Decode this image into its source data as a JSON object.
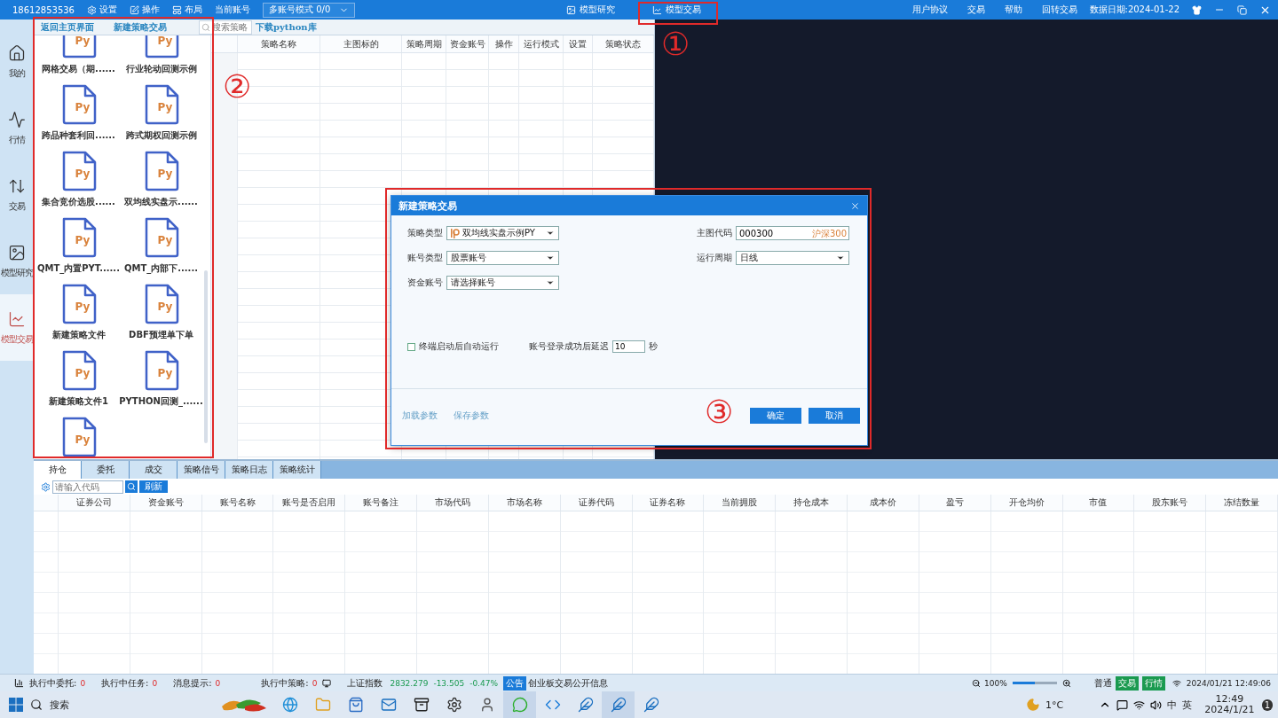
{
  "top_bar": {
    "phone": "18612853536",
    "menu": [
      {
        "label": "设置",
        "kind": "settings"
      },
      {
        "label": "操作",
        "kind": "edit"
      },
      {
        "label": "布局",
        "kind": "layout"
      }
    ],
    "account_label": "当前账号",
    "account_mode": "多账号模式 0/0",
    "modules": [
      {
        "label": "模型研究",
        "kind": "research"
      },
      {
        "label": "模型交易",
        "kind": "trade"
      }
    ],
    "links": [
      "用户协议",
      "交易",
      "帮助",
      "回转交易"
    ],
    "data_date": "数据日期:2024-01-22"
  },
  "sidebar": {
    "items": [
      {
        "label": "我的",
        "kind": "home",
        "selected": false
      },
      {
        "label": "行情",
        "kind": "market",
        "selected": false
      },
      {
        "label": "交易",
        "kind": "trade",
        "selected": false
      },
      {
        "label": "模型研究",
        "kind": "research",
        "selected": false
      },
      {
        "label": "模型交易",
        "kind": "model",
        "selected": true
      }
    ]
  },
  "file_panel": {
    "back": "返回主页界面",
    "new": "新建策略交易",
    "search": {
      "placeholder": "搜索策略"
    },
    "download": "下载python库",
    "files": [
      {
        "badge": "Py",
        "label": "网格交易（期......"
      },
      {
        "badge": "Py",
        "label": "行业轮动回测示例"
      },
      {
        "badge": "Py",
        "label": "跨品种套利回......"
      },
      {
        "badge": "Py",
        "label": "跨式期权回测示例"
      },
      {
        "badge": "Py",
        "label": "集合竞价选股......"
      },
      {
        "badge": "Py",
        "label": "双均线实盘示......"
      },
      {
        "badge": "Py",
        "label": "QMT_内置PYT......"
      },
      {
        "badge": "Py",
        "label": "QMT_内部下......"
      },
      {
        "badge": "Py",
        "label": "新建策略文件"
      },
      {
        "badge": "Py",
        "label": "DBF预埋单下单"
      },
      {
        "badge": "Py",
        "label": "新建策略文件1"
      },
      {
        "badge": "Py",
        "label": "PYTHON回测_......"
      },
      {
        "badge": "Py"
      }
    ]
  },
  "strategy_table": {
    "columns": [
      "策略名称",
      "主图标的",
      "策略周期",
      "资金账号",
      "操作",
      "运行模式",
      "设置",
      "策略状态"
    ]
  },
  "dialog": {
    "title": "新建策略交易",
    "fields": [
      {
        "label": "策略类型",
        "kind": "script",
        "value": "双均线实盘示例PY"
      },
      {
        "label": "主图代码",
        "kind": "code",
        "value": "000300",
        "hint": "沪深300"
      },
      {
        "label": "账号类型",
        "kind": "select",
        "value": "股票账号"
      },
      {
        "label": "运行周期",
        "kind": "select",
        "value": "日线"
      },
      {
        "label": "资金账号",
        "kind": "select",
        "value": "请选择账号"
      }
    ],
    "auto_run": {
      "label": "终端启动后自动运行",
      "checked": false
    },
    "delay": {
      "label": "账号登录成功后延迟",
      "value": "10",
      "unit": "秒"
    },
    "links": [
      "加载参数",
      "保存参数"
    ],
    "buttons": [
      "确定",
      "取消"
    ]
  },
  "annotations": [
    {
      "label": "①"
    },
    {
      "label": "②"
    },
    {
      "label": "③"
    }
  ],
  "bottom_panel": {
    "tabs": [
      {
        "label": "持仓",
        "selected": true
      },
      {
        "label": "委托",
        "selected": false
      },
      {
        "label": "成交",
        "selected": false
      },
      {
        "label": "策略信号",
        "selected": false
      },
      {
        "label": "策略日志",
        "selected": false
      },
      {
        "label": "策略统计",
        "selected": false
      }
    ],
    "search": {
      "placeholder": "请输入代码"
    },
    "refresh": "刷新",
    "columns": [
      "证券公司",
      "资金账号",
      "账号名称",
      "账号是否启用",
      "账号备注",
      "市场代码",
      "市场名称",
      "证券代码",
      "证券名称",
      "当前拥股",
      "持仓成本",
      "成本价",
      "盈亏",
      "开仓均价",
      "市值",
      "股东账号",
      "冻结数量"
    ]
  },
  "status_bar": {
    "counters": [
      {
        "label": "执行中委托:",
        "value": "0"
      },
      {
        "label": "执行中任务:",
        "value": "0"
      },
      {
        "label": "消息提示:",
        "value": "0"
      },
      {
        "label": "执行中策略:",
        "value": "0"
      }
    ],
    "index_name": "上证指数",
    "index_value": "2832.279",
    "index_change": "-13.505",
    "index_pct": "-0.47%",
    "notice_badge": "公告",
    "notice": "创业板交易公开信息",
    "zoom": "100%",
    "level": 0.5,
    "mode": "普通",
    "badges": [
      "交易",
      "行情"
    ],
    "datetime": "2024/01/21 12:49:06"
  },
  "taskbar": {
    "search": "搜索",
    "apps": [
      {
        "kind": "browser",
        "selected": false
      },
      {
        "kind": "folder",
        "selected": false
      },
      {
        "kind": "store",
        "selected": false
      },
      {
        "kind": "mail",
        "selected": false
      },
      {
        "kind": "archive",
        "selected": false
      },
      {
        "kind": "settings",
        "selected": false
      },
      {
        "kind": "avatar",
        "selected": false
      },
      {
        "kind": "chat",
        "selected": true
      },
      {
        "kind": "code",
        "selected": false
      },
      {
        "kind": "feather",
        "selected": false
      },
      {
        "kind": "feather",
        "selected": true
      },
      {
        "kind": "feather",
        "selected": false
      }
    ],
    "weather": "1°C",
    "tray": [
      "中",
      "英"
    ],
    "time": "12:49",
    "date": "2024/1/21",
    "notifications": "1"
  }
}
